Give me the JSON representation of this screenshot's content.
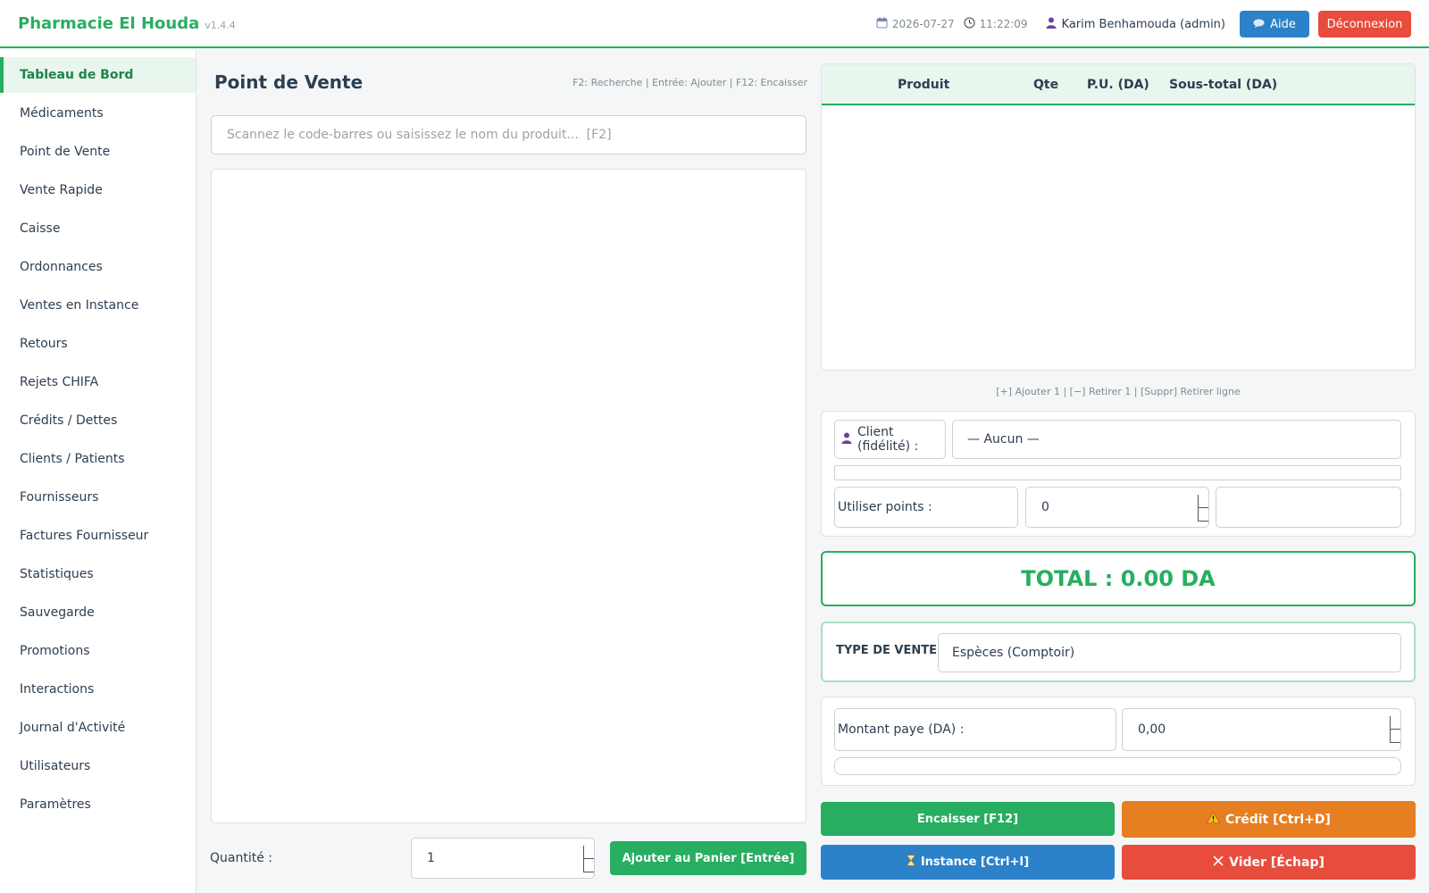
{
  "header": {
    "brand": "Pharmacie El Houda",
    "version": "v1.4.4",
    "date": "2026-07-27",
    "time": "11:22:09",
    "user": "Karim Benhamouda (admin)",
    "help_label": "Aide",
    "logout_label": "Déconnexion"
  },
  "sidebar": {
    "items": [
      {
        "label": "Tableau de Bord"
      },
      {
        "label": "Médicaments"
      },
      {
        "label": "Point de Vente"
      },
      {
        "label": "Vente Rapide"
      },
      {
        "label": "Caisse"
      },
      {
        "label": "Ordonnances"
      },
      {
        "label": "Ventes en Instance"
      },
      {
        "label": "Retours"
      },
      {
        "label": "Rejets CHIFA"
      },
      {
        "label": "Crédits / Dettes"
      },
      {
        "label": "Clients / Patients"
      },
      {
        "label": "Fournisseurs"
      },
      {
        "label": "Factures Fournisseur"
      },
      {
        "label": "Statistiques"
      },
      {
        "label": "Sauvegarde"
      },
      {
        "label": "Promotions"
      },
      {
        "label": "Interactions"
      },
      {
        "label": "Journal d'Activité"
      },
      {
        "label": "Utilisateurs"
      },
      {
        "label": "Paramètres"
      }
    ]
  },
  "pos": {
    "title": "Point de Vente",
    "shortcuts": "F2: Recherche  |  Entrée: Ajouter  |  F12: Encaisser",
    "search_placeholder": "Scannez le code-barres ou saisissez le nom du produit...  [F2]",
    "quantity_label": "Quantité :",
    "quantity_value": "1",
    "add_label": "Ajouter au Panier  [Entrée]"
  },
  "cart": {
    "columns": [
      "Produit",
      "Qte",
      "P.U. (DA)",
      "Sous-total (DA)"
    ],
    "hint": "[+] Ajouter 1  |  [−] Retirer 1  |  [Suppr] Retirer ligne"
  },
  "client": {
    "label": "Client (fidélité) :",
    "value": "— Aucun —",
    "points_label": "Utiliser points :",
    "points_value": "0"
  },
  "total": {
    "text": "TOTAL : 0.00 DA"
  },
  "sale_type": {
    "label": "TYPE DE VENTE :",
    "value": "Espèces (Comptoir)"
  },
  "payment": {
    "label": "Montant paye (DA) :",
    "value": "0,00"
  },
  "actions": {
    "cash": "Encaisser  [F12]",
    "credit": "Crédit  [Ctrl+D]",
    "instance": "Instance  [Ctrl+I]",
    "clear": "Vider  [Échap]"
  },
  "colors": {
    "primary": "#27ae60",
    "info": "#2c82c9",
    "danger": "#e74c3c",
    "warning": "#e67e22"
  }
}
